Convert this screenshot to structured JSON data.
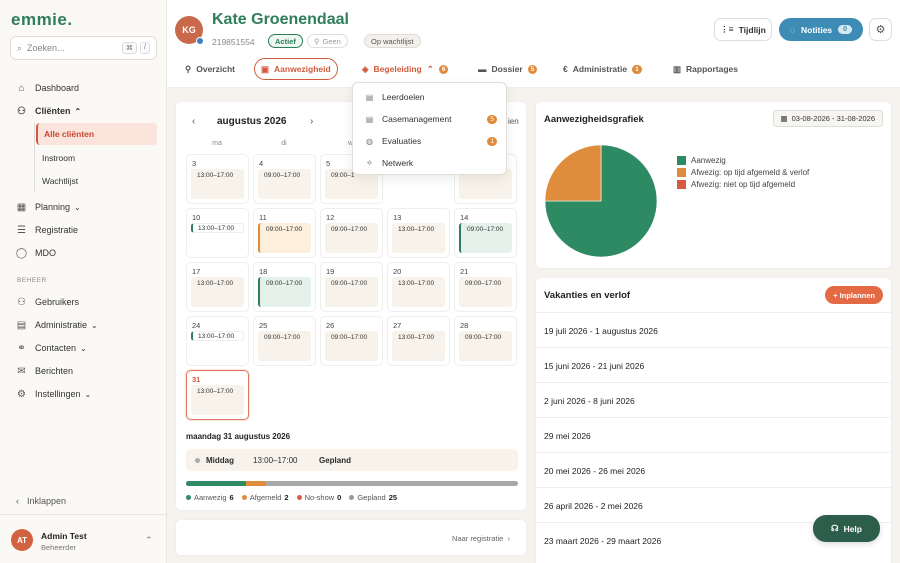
{
  "sidebar": {
    "logo": "emmie.",
    "search_placeholder": "Zoeken...",
    "kbd1": "⌘",
    "kbd2": "/",
    "items": {
      "dashboard": "Dashboard",
      "clienten": "Cliënten",
      "alle_clienten": "Alle cliënten",
      "instroom": "Instroom",
      "wachtlijst": "Wachtlijst",
      "planning": "Planning",
      "registratie": "Registratie",
      "mdo": "MDO",
      "beheer": "BEHEER",
      "gebruikers": "Gebruikers",
      "administratie": "Administratie",
      "contacten": "Contacten",
      "berichten": "Berichten",
      "instellingen": "Instellingen"
    },
    "collapse": "Inklappen",
    "user": {
      "initials": "AT",
      "name": "Admin Test",
      "role": "Beheerder"
    }
  },
  "header": {
    "initials": "KG",
    "name": "Kate Groenendaal",
    "client_id": "219851554",
    "badge_actief": "Actief",
    "badge_geen": "Geen",
    "badge_wachtlijst": "Op wachtlijst",
    "tijdlijn": "Tijdlijn",
    "notities": "Notities",
    "notities_count": "0"
  },
  "tabs": {
    "overzicht": "Overzicht",
    "aanwezigheid": "Aanwezigheid",
    "begeleiding": "Begeleiding",
    "begeleiding_count": "6",
    "dossier": "Dossier",
    "dossier_count": "5",
    "administratie": "Administratie",
    "administratie_count": "1",
    "rapportages": "Rapportages"
  },
  "dropdown": {
    "leerdoelen": "Leerdoelen",
    "casemanagement": "Casemanagement",
    "casemanagement_count": "5",
    "evaluaties": "Evaluaties",
    "evaluaties_count": "1",
    "netwerk": "Netwerk"
  },
  "calendar": {
    "month": "augustus 2026",
    "prev": "‹",
    "next": "›",
    "cut_text": "ien",
    "dow": [
      "ma",
      "di",
      "w"
    ],
    "days": [
      {
        "n": "3",
        "t": "13:00–17:00",
        "s": "plain"
      },
      {
        "n": "4",
        "t": "09:00–17:00",
        "s": "plain"
      },
      {
        "n": "5",
        "t": "09:00–1",
        "s": "plain"
      },
      {
        "n": "",
        "t": "",
        "s": "blank"
      },
      {
        "n": "",
        "t": "",
        "s": "plain-empty"
      },
      {
        "n": "10",
        "t": "13:00–17:00",
        "s": "pill"
      },
      {
        "n": "11",
        "t": "09:00–17:00",
        "s": "orange"
      },
      {
        "n": "12",
        "t": "09:00–17:00",
        "s": "plain"
      },
      {
        "n": "13",
        "t": "13:00–17:00",
        "s": "plain"
      },
      {
        "n": "14",
        "t": "09:00–17:00",
        "s": "green"
      },
      {
        "n": "17",
        "t": "13:00–17:00",
        "s": "plain"
      },
      {
        "n": "18",
        "t": "09:00–17:00",
        "s": "green"
      },
      {
        "n": "19",
        "t": "09:00–17:00",
        "s": "plain"
      },
      {
        "n": "20",
        "t": "13:00–17:00",
        "s": "plain"
      },
      {
        "n": "21",
        "t": "09:00–17:00",
        "s": "plain"
      },
      {
        "n": "24",
        "t": "13:00–17:00",
        "s": "pill"
      },
      {
        "n": "25",
        "t": "09:00–17:00",
        "s": "plain"
      },
      {
        "n": "26",
        "t": "09:00–17:00",
        "s": "plain"
      },
      {
        "n": "27",
        "t": "13:00–17:00",
        "s": "plain"
      },
      {
        "n": "28",
        "t": "09:00–17:00",
        "s": "plain"
      },
      {
        "n": "31",
        "t": "13:00–17:00",
        "s": "today"
      }
    ],
    "selected_day": "maandag 31 augustus 2026",
    "selected_part": "Middag",
    "selected_time": "13:00–17:00",
    "selected_status": "Gepland",
    "progress": {
      "aanwezig": 6,
      "afgemeld": 2,
      "noshow": 0,
      "gepland": 25
    },
    "legend": {
      "aanwezig": "Aanwezig",
      "aanwezig_n": "6",
      "afgemeld": "Afgemeld",
      "afgemeld_n": "2",
      "noshow": "No-show",
      "noshow_n": "0",
      "gepland": "Gepland",
      "gepland_n": "25"
    },
    "naar_registratie": "Naar registratie"
  },
  "attendance_chart": {
    "title": "Aanwezigheidsgrafiek",
    "date_range": "03-08-2026 - 31-08-2026",
    "legend": [
      "Aanwezig",
      "Afwezig: op tijd afgemeld & verlof",
      "Afwezig: niet op tijd afgemeld"
    ],
    "colors": [
      "#2e8a63",
      "#df8d3c",
      "#d65a44"
    ],
    "values": [
      75,
      25,
      0
    ]
  },
  "vacations": {
    "title": "Vakanties en verlof",
    "button": "+ Inplannen",
    "items": [
      "19 juli 2026 - 1 augustus 2026",
      "15 juni 2026 - 21 juni 2026",
      "2 juni 2026 - 8 juni 2026",
      "29 mei 2026",
      "20 mei 2026 - 26 mei 2026",
      "26 april 2026 - 2 mei 2026",
      "23 maart 2026 - 29 maart 2026"
    ]
  },
  "help": "Help"
}
